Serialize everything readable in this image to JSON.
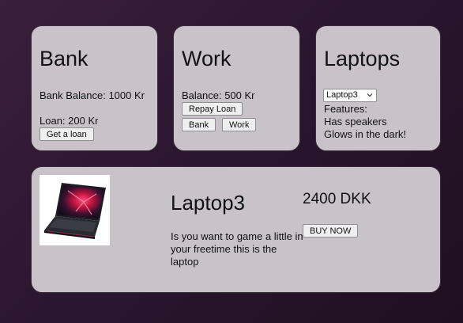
{
  "bank": {
    "title": "Bank",
    "balance_text": "Bank Balance: 1000 Kr",
    "loan_text": "Loan: 200 Kr",
    "get_loan_label": "Get a loan"
  },
  "work": {
    "title": "Work",
    "balance_text": "Balance: 500 Kr",
    "repay_label": "Repay Loan",
    "bank_label": "Bank",
    "work_label": "Work"
  },
  "laptops": {
    "title": "Laptops",
    "selected": "Laptop3",
    "features_label": "Features:",
    "features": [
      "Has speakers",
      "Glows in the dark!"
    ]
  },
  "product": {
    "name": "Laptop3",
    "description": "Is you want to game a little in your freetime this is the laptop",
    "price": "2400 DKK",
    "buy_label": "BUY NOW",
    "image_icon": "laptop-image"
  },
  "colors": {
    "card_bg": "#c9c3c9",
    "background_start": "#3a1f3b",
    "background_end": "#1f0f20",
    "laptop_glow": "#d01a4a"
  }
}
